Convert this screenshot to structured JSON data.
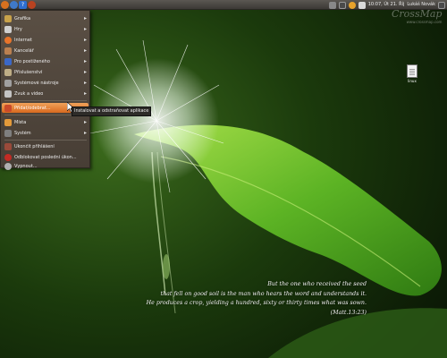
{
  "panel": {
    "clock": "10:07, Út 21. Říj",
    "user": "Lukáš Novák"
  },
  "watermark": {
    "main": "CrossMap",
    "sub": "www.crossmap.com"
  },
  "menu": {
    "items": [
      {
        "label": "Grafika",
        "icon": "image-icon",
        "color": "#c9a24a",
        "submenu": true
      },
      {
        "label": "Hry",
        "icon": "cards-icon",
        "color": "#d0d0d0",
        "submenu": true
      },
      {
        "label": "Internet",
        "icon": "internet-icon",
        "color": "#e8742a",
        "submenu": true
      },
      {
        "label": "Kancelář",
        "icon": "office-icon",
        "color": "#bb8050",
        "submenu": true
      },
      {
        "label": "Pro postiženého",
        "icon": "accessibility-icon",
        "color": "#3b68c7",
        "submenu": true
      },
      {
        "label": "Příslušenství",
        "icon": "accessories-icon",
        "color": "#bfae86",
        "submenu": true
      },
      {
        "label": "Systémové nástroje",
        "icon": "system-tools-icon",
        "color": "#a0a0a0",
        "submenu": true
      },
      {
        "label": "Zvuk a video",
        "icon": "multimedia-icon",
        "color": "#c4c4c4",
        "submenu": true
      },
      {
        "label": "Přidat/odebrat...",
        "icon": "add-remove-icon",
        "color": "#c94a2a",
        "submenu": false
      },
      {
        "label": "Místa",
        "icon": "folder-icon",
        "color": "#e49a3a",
        "submenu": true
      },
      {
        "label": "Systém",
        "icon": "preferences-icon",
        "color": "#7f7f7f",
        "submenu": true
      },
      {
        "label": "Ukončit přihlášení",
        "icon": "logout-icon",
        "color": "#9a4a3a",
        "submenu": false
      },
      {
        "label": "Odblokovat poslední úkon...",
        "icon": "shutdown-icon",
        "color": "#c32b24",
        "submenu": false
      },
      {
        "label": "Vypnout...",
        "icon": "power-icon",
        "color": "#b0b0b0",
        "submenu": false
      }
    ]
  },
  "tooltip": "Instalovat a odstraňovat aplikace",
  "desktop_file": "linux",
  "verse": {
    "line1": "But the one who received the seed",
    "line2": "that fell on good soil is the man who hears the word and understands it.",
    "line3": "He produces a crop, yielding a hundred, sixty or thirty times what was sown.",
    "line4": "(Matt.13:23)"
  }
}
